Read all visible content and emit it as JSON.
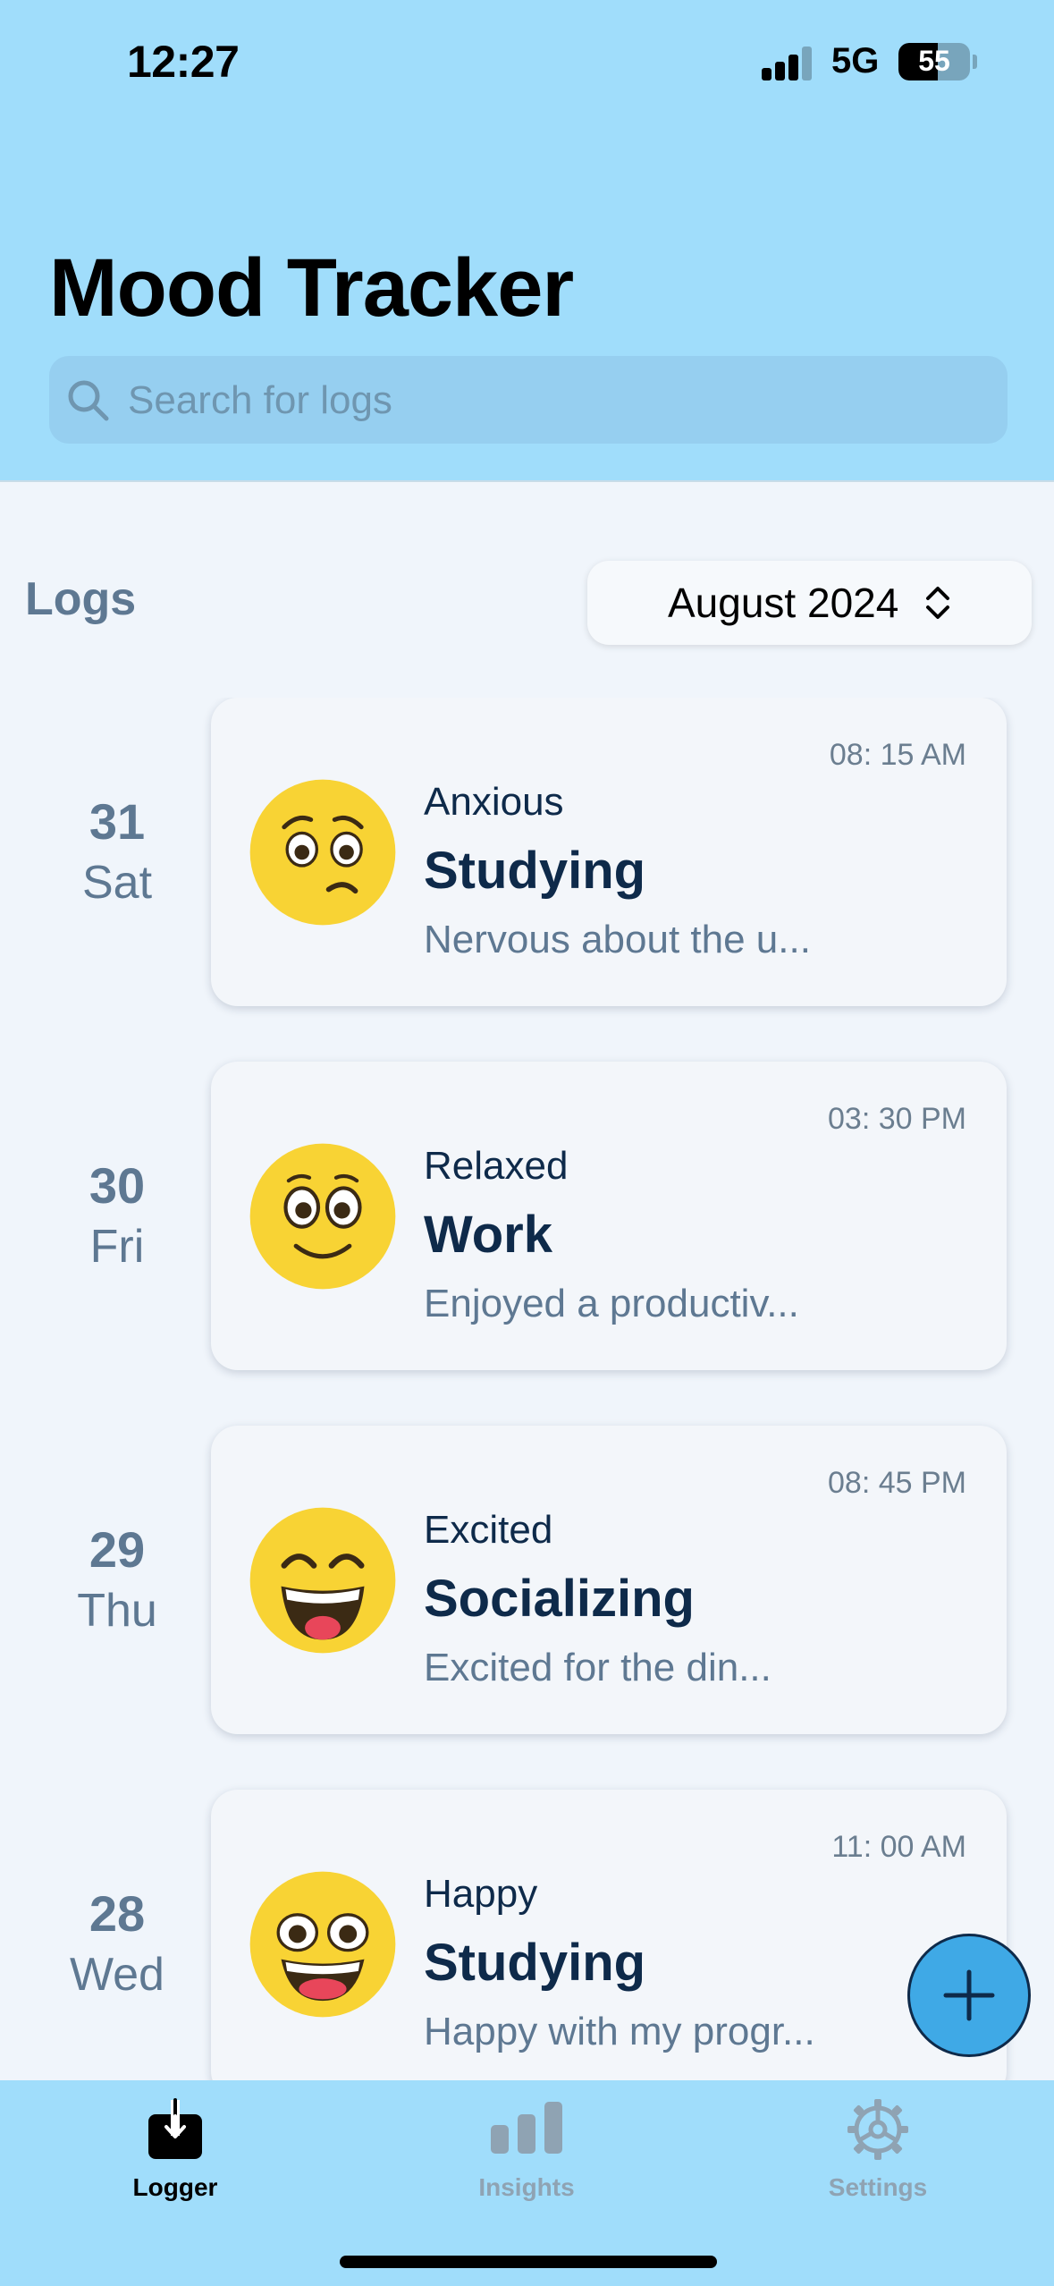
{
  "status_bar": {
    "time": "12:27",
    "network": "5G",
    "battery": "55",
    "battery_level": 0.55,
    "signal_bars": 3
  },
  "header": {
    "title": "Mood Tracker",
    "search_placeholder": "Search for logs",
    "search_icon": "search-icon"
  },
  "logs_section": {
    "label": "Logs",
    "month_selector": "August 2024",
    "month_selector_icon": "chevron-up-down-icon"
  },
  "entries": [
    {
      "day": "31",
      "weekday": "Sat",
      "time": "08: 15 AM",
      "mood": "Anxious",
      "activity": "Studying",
      "note": "Nervous about the u...",
      "emoji": "anxious-emoji"
    },
    {
      "day": "30",
      "weekday": "Fri",
      "time": "03: 30 PM",
      "mood": "Relaxed",
      "activity": "Work",
      "note": "Enjoyed a productiv...",
      "emoji": "relaxed-emoji"
    },
    {
      "day": "29",
      "weekday": "Thu",
      "time": "08: 45 PM",
      "mood": "Excited",
      "activity": "Socializing",
      "note": "Excited for the din...",
      "emoji": "excited-emoji"
    },
    {
      "day": "28",
      "weekday": "Wed",
      "time": "11: 00 AM",
      "mood": "Happy",
      "activity": "Studying",
      "note": "Happy with my progr...",
      "emoji": "happy-emoji"
    }
  ],
  "fab": {
    "icon": "plus-icon"
  },
  "tabbar": {
    "tabs": [
      {
        "label": "Logger",
        "icon": "tray-download-icon",
        "active": true
      },
      {
        "label": "Insights",
        "icon": "bar-chart-icon",
        "active": false
      },
      {
        "label": "Settings",
        "icon": "gear-icon",
        "active": false
      }
    ]
  },
  "colors": {
    "header_bg": "#A0DDFB",
    "page_bg": "#F0F5FB",
    "card_bg": "#F3F6FA",
    "accent": "#3FA9E6",
    "text_dark": "#0E2A4A",
    "text_muted": "#5E7892",
    "tab_inactive": "#8FA3B3",
    "emoji_yellow": "#F8D334"
  }
}
